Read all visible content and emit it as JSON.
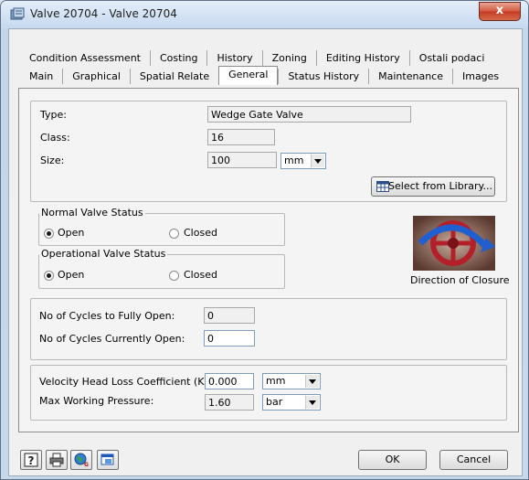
{
  "window": {
    "title": "Valve 20704 - Valve 20704",
    "close_glyph": "x"
  },
  "tabs": {
    "row1": [
      "Condition Assessment",
      "Costing",
      "History",
      "Zoning",
      "Editing History",
      "Ostali podaci"
    ],
    "row2": [
      "Main",
      "Graphical",
      "Spatial Relate",
      "General",
      "Status History",
      "Maintenance",
      "Images"
    ],
    "active": "General"
  },
  "general": {
    "type_label": "Type:",
    "type_value": "Wedge Gate Valve",
    "class_label": "Class:",
    "class_value": "16",
    "size_label": "Size:",
    "size_value": "100",
    "size_unit": "mm",
    "library_button": "Select from Library..."
  },
  "normal_status": {
    "legend": "Normal Valve Status",
    "open": "Open",
    "closed": "Closed",
    "selected": "Open"
  },
  "operational_status": {
    "legend": "Operational Valve Status",
    "open": "Open",
    "closed": "Closed",
    "selected": "Open"
  },
  "closure": {
    "label": "Direction of Closure",
    "image_icon": "valve-handwheel-icon"
  },
  "cycles": {
    "fully_open_label": "No of Cycles to Fully Open:",
    "fully_open_value": "0",
    "currently_open_label": "No of Cycles Currently Open:",
    "currently_open_value": "0"
  },
  "hydraulics": {
    "velocity_label": "Velocity Head Loss Coefficient (Kv):",
    "velocity_value": "0.000",
    "velocity_unit": "mm",
    "pressure_label": "Max Working Pressure:",
    "pressure_value": "1.60",
    "pressure_unit": "bar"
  },
  "footer": {
    "icons": [
      "help-icon",
      "print-icon",
      "gis-icon",
      "window-icon"
    ],
    "ok": "OK",
    "cancel": "Cancel"
  }
}
